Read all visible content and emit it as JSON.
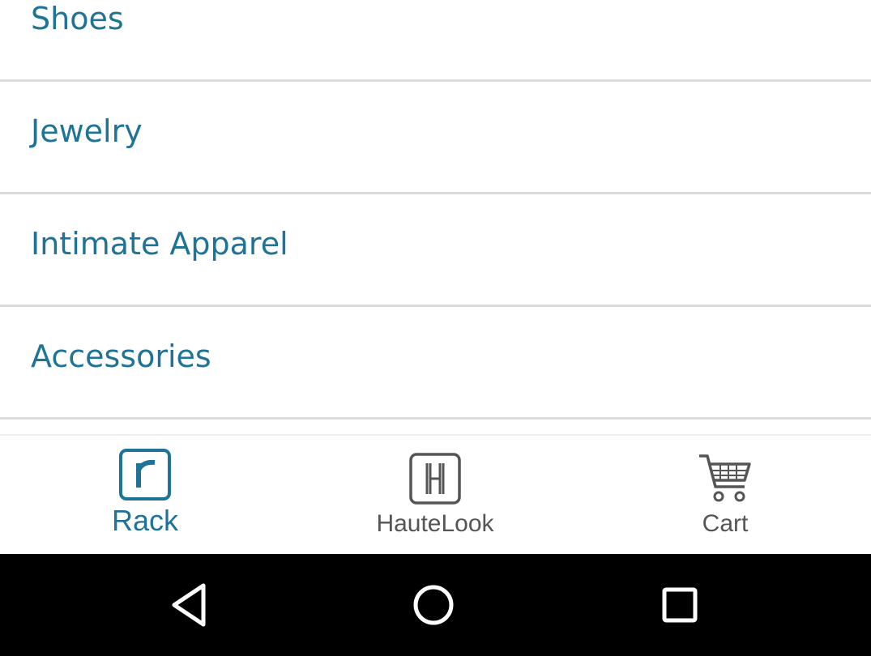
{
  "categories": [
    {
      "label": "Shoes"
    },
    {
      "label": "Jewelry"
    },
    {
      "label": "Intimate Apparel"
    },
    {
      "label": "Accessories"
    }
  ],
  "tabs": {
    "rack": {
      "label": "Rack",
      "icon": "rack-r-icon",
      "active": true
    },
    "hautelook": {
      "label": "HauteLook",
      "icon": "hautelook-h-icon",
      "active": false
    },
    "cart": {
      "label": "Cart",
      "icon": "shopping-cart-icon",
      "active": false
    }
  },
  "nav_bar": {
    "back": "back-triangle-icon",
    "home": "home-circle-icon",
    "recents": "recents-square-icon"
  },
  "colors": {
    "accent": "#1f7396",
    "inactive": "#555555",
    "divider": "#dcdcdc",
    "nav_background": "#000000"
  }
}
